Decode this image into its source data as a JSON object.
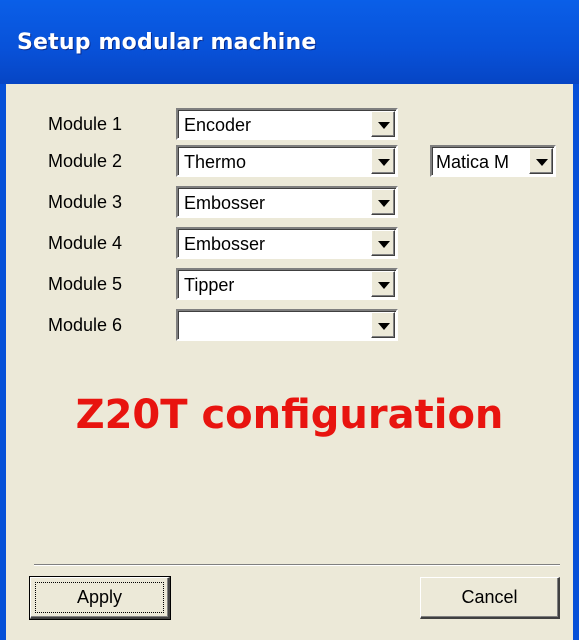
{
  "window": {
    "title": "Setup modular machine"
  },
  "modules": [
    {
      "label": "Module 1",
      "value": "Encoder"
    },
    {
      "label": "Module 2",
      "value": "Thermo"
    },
    {
      "label": "Module 3",
      "value": "Embosser"
    },
    {
      "label": "Module 4",
      "value": "Embosser"
    },
    {
      "label": "Module 5",
      "value": "Tipper"
    },
    {
      "label": "Module 6",
      "value": ""
    }
  ],
  "thermo_option": {
    "value": "Matica M"
  },
  "configuration_label": "Z20T configuration",
  "buttons": {
    "apply": "Apply",
    "cancel": "Cancel"
  },
  "colors": {
    "title_bar": "#0851d8",
    "dialog_bg": "#ece9d8",
    "config_text": "#e8140f"
  }
}
